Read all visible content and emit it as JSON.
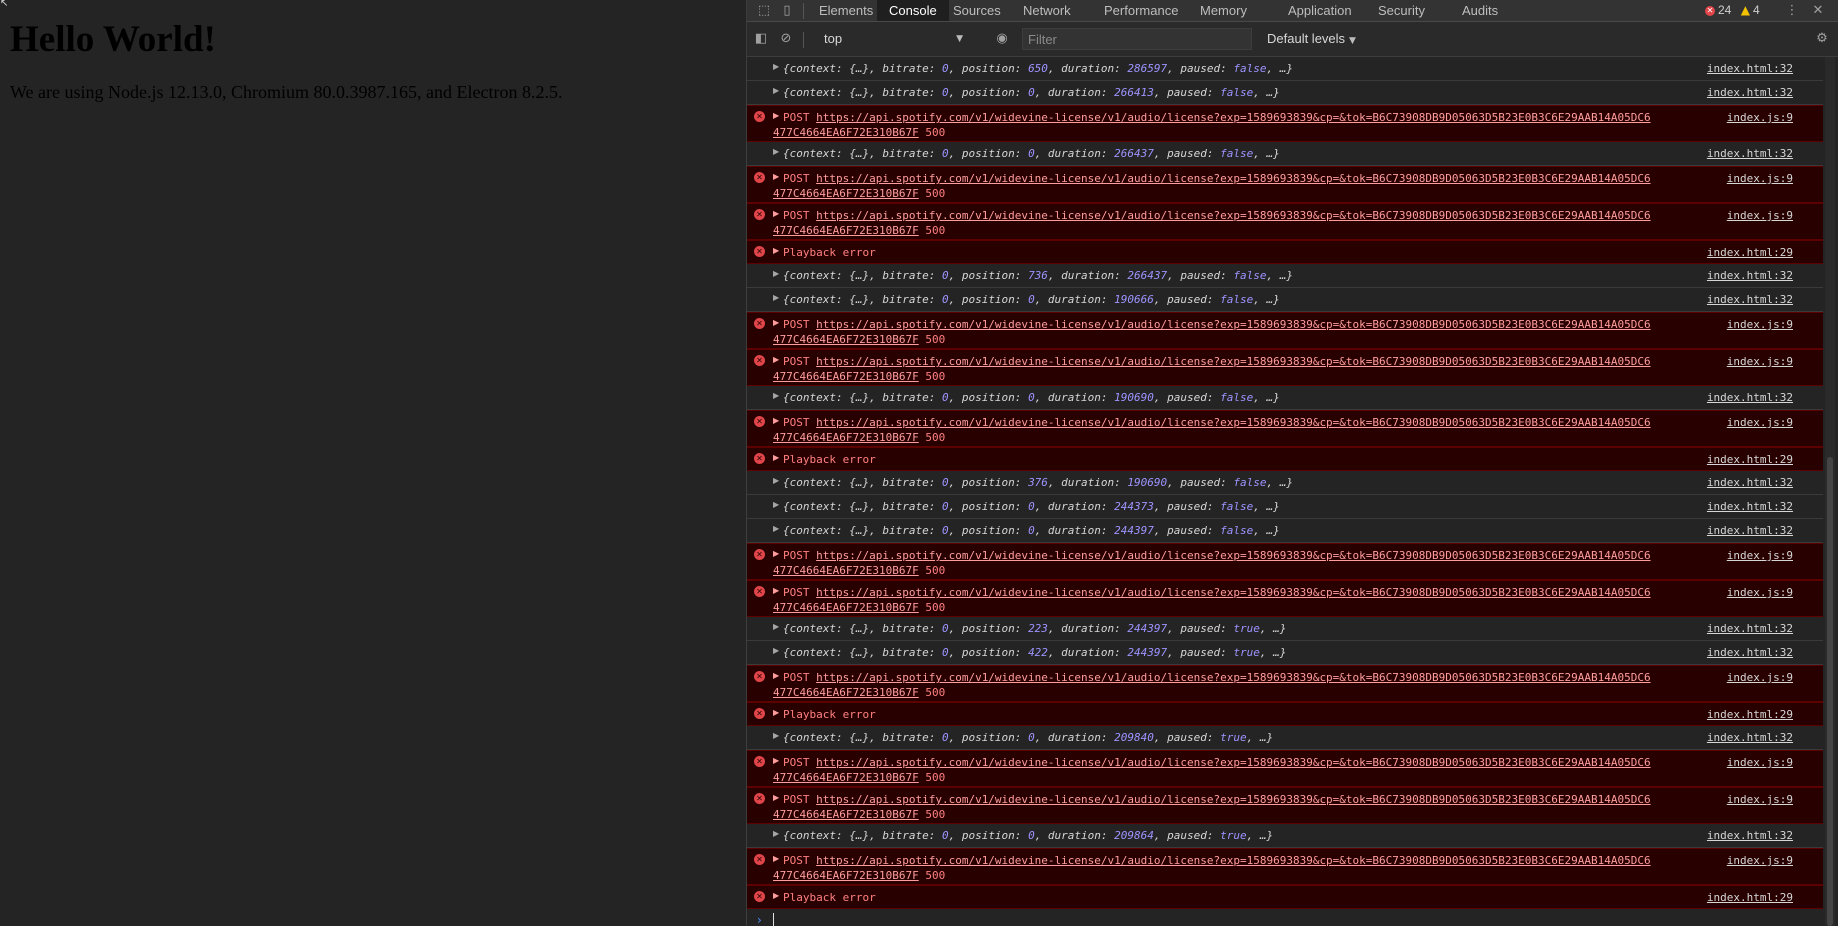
{
  "page": {
    "heading": "Hello World!",
    "paragraph": "We are using Node.js 12.13.0, Chromium 80.0.3987.165, and Electron 8.2.5."
  },
  "devtools": {
    "tabs": [
      "Elements",
      "Console",
      "Sources",
      "Network",
      "Performance",
      "Memory",
      "Application",
      "Security",
      "Audits"
    ],
    "active_tab": "Console",
    "error_count": "24",
    "warning_count": "4",
    "context": "top",
    "filter_placeholder": "Filter",
    "levels": "Default levels"
  },
  "log": [
    {
      "type": "obj",
      "position": "650",
      "duration": "286597",
      "paused": "false",
      "src": "index.html:32"
    },
    {
      "type": "obj",
      "position": "0",
      "duration": "266413",
      "paused": "false",
      "src": "index.html:32"
    },
    {
      "type": "post",
      "src": "index.js:9"
    },
    {
      "type": "obj",
      "position": "0",
      "duration": "266437",
      "paused": "false",
      "src": "index.html:32"
    },
    {
      "type": "post",
      "src": "index.js:9"
    },
    {
      "type": "post",
      "src": "index.js:9"
    },
    {
      "type": "pberr",
      "src": "index.html:29"
    },
    {
      "type": "obj",
      "position": "736",
      "duration": "266437",
      "paused": "false",
      "src": "index.html:32"
    },
    {
      "type": "obj",
      "position": "0",
      "duration": "190666",
      "paused": "false",
      "src": "index.html:32"
    },
    {
      "type": "post",
      "src": "index.js:9"
    },
    {
      "type": "post",
      "src": "index.js:9"
    },
    {
      "type": "obj",
      "position": "0",
      "duration": "190690",
      "paused": "false",
      "src": "index.html:32"
    },
    {
      "type": "post",
      "src": "index.js:9"
    },
    {
      "type": "pberr",
      "src": "index.html:29"
    },
    {
      "type": "obj",
      "position": "376",
      "duration": "190690",
      "paused": "false",
      "src": "index.html:32"
    },
    {
      "type": "obj",
      "position": "0",
      "duration": "244373",
      "paused": "false",
      "src": "index.html:32"
    },
    {
      "type": "obj",
      "position": "0",
      "duration": "244397",
      "paused": "false",
      "src": "index.html:32"
    },
    {
      "type": "post",
      "src": "index.js:9"
    },
    {
      "type": "post",
      "src": "index.js:9"
    },
    {
      "type": "obj",
      "position": "223",
      "duration": "244397",
      "paused": "true",
      "src": "index.html:32"
    },
    {
      "type": "obj",
      "position": "422",
      "duration": "244397",
      "paused": "true",
      "src": "index.html:32"
    },
    {
      "type": "post",
      "src": "index.js:9"
    },
    {
      "type": "pberr",
      "src": "index.html:29"
    },
    {
      "type": "obj",
      "position": "0",
      "duration": "209840",
      "paused": "true",
      "src": "index.html:32"
    },
    {
      "type": "post",
      "src": "index.js:9"
    },
    {
      "type": "post",
      "src": "index.js:9"
    },
    {
      "type": "obj",
      "position": "0",
      "duration": "209864",
      "paused": "true",
      "src": "index.html:32"
    },
    {
      "type": "post",
      "src": "index.js:9"
    },
    {
      "type": "pberr",
      "src": "index.html:29"
    }
  ],
  "post_message": {
    "method": "POST",
    "url_line1": "https://api.spotify.com/v1/widevine-license/v1/audio/license?exp=1589693839&cp=&tok=B6C73908DB9D05063D5B23E0B3C6E29AAB14A05DC6",
    "url_line2": "477C4664EA6F72E310B67F",
    "status": "500"
  },
  "obj_message": {
    "context": "{context: {…}",
    "bitrate": "0",
    "ellipsis": "…}"
  },
  "playback_error": "Playback error"
}
